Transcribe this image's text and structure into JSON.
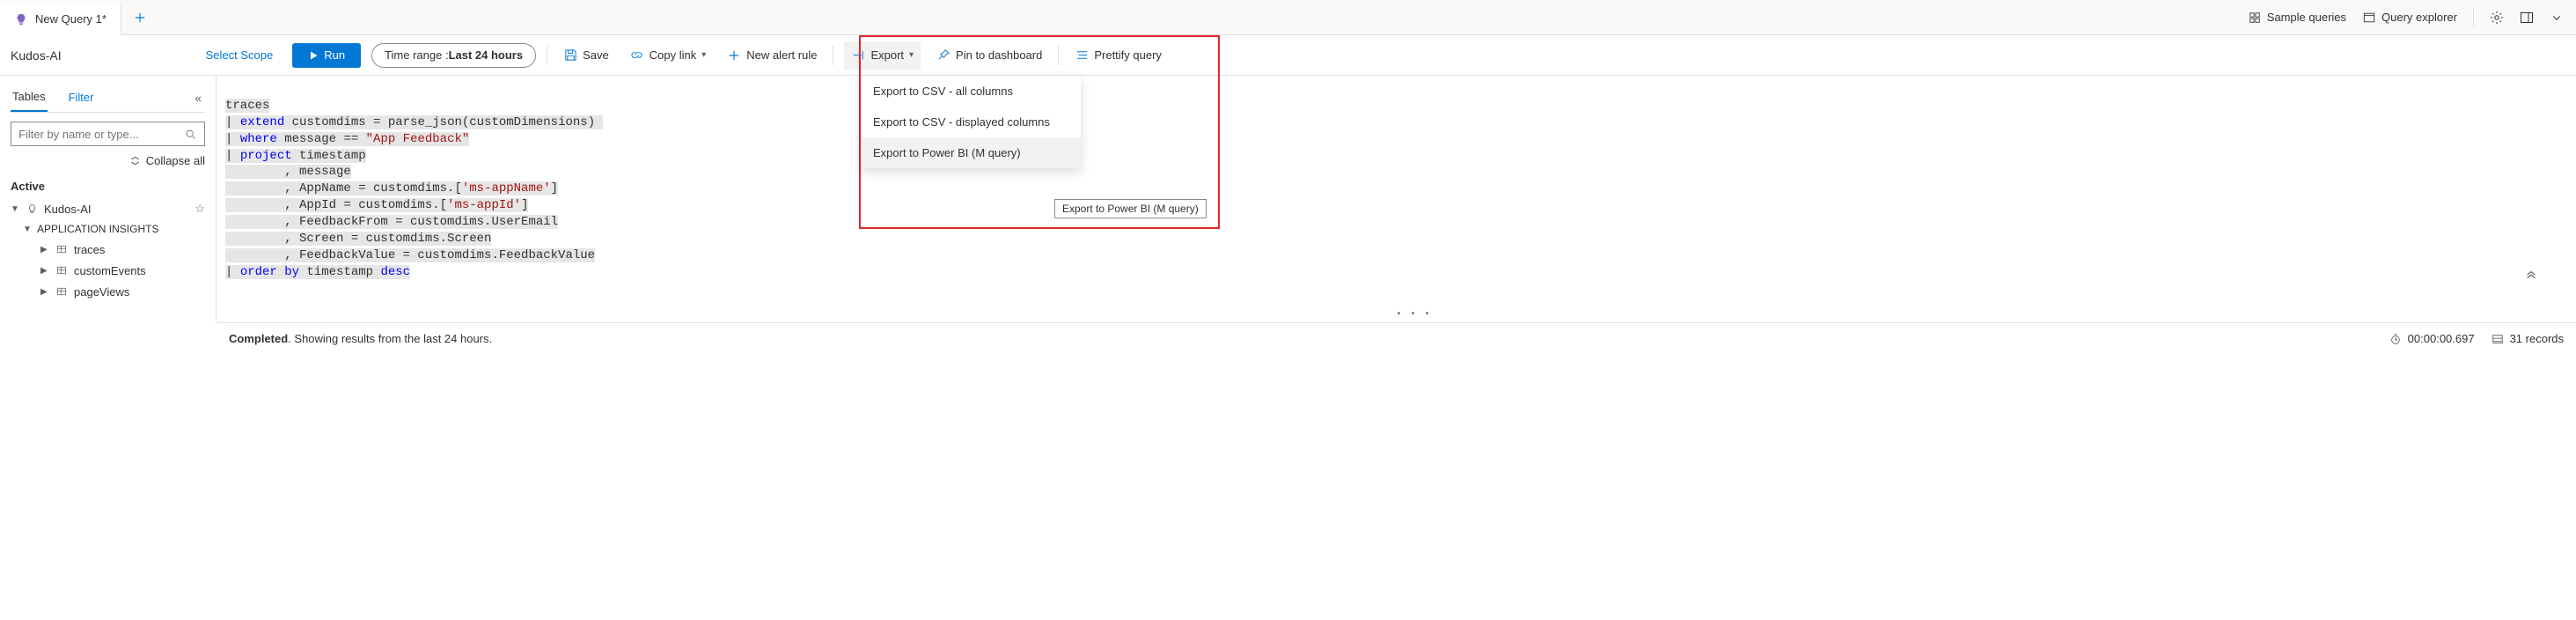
{
  "tabStrip": {
    "active": "New Query 1*",
    "right": {
      "sample": "Sample queries",
      "explorer": "Query explorer"
    }
  },
  "toolbar": {
    "breadcrumb": "Kudos-AI",
    "selectScope": "Select Scope",
    "run": "Run",
    "timeRangeLabel": "Time range : ",
    "timeRangeValue": "Last 24 hours",
    "save": "Save",
    "copy": "Copy link",
    "newAlert": "New alert rule",
    "export": "Export",
    "pin": "Pin to dashboard",
    "prettify": "Prettify query"
  },
  "exportMenu": {
    "items": [
      "Export to CSV - all columns",
      "Export to CSV - displayed columns",
      "Export to Power BI (M query)"
    ],
    "tooltip": "Export to Power BI (M query)"
  },
  "sidebar": {
    "tabs": {
      "tables": "Tables",
      "filter": "Filter"
    },
    "filterPlaceholder": "Filter by name or type...",
    "collapseAll": "Collapse all",
    "activeHdr": "Active",
    "root": "Kudos-AI",
    "group": "APPLICATION INSIGHTS",
    "items": [
      "traces",
      "customEvents",
      "pageViews"
    ]
  },
  "editor": {
    "line1": "traces",
    "extendKw": "extend",
    "extendRest": " customdims = parse_json(customDimensions)",
    "whereKw": "where",
    "whereMid": " message == ",
    "whereStr": "\"App Feedback\"",
    "projectKw": "project",
    "projectHead": " timestamp",
    "p1": "        , message",
    "p2a": "        , AppName = customdims.[",
    "p2s": "'ms-appName'",
    "p2b": "]",
    "p3a": "        , AppId = customdims.[",
    "p3s": "'ms-appId'",
    "p3b": "]",
    "p4": "        , FeedbackFrom = customdims.UserEmail",
    "p5": "        , Screen = customdims.Screen",
    "p6": "        , FeedbackValue = customdims.FeedbackValue",
    "orderKw": "order by",
    "orderRest": " timestamp ",
    "descKw": "desc"
  },
  "status": {
    "completed": "Completed",
    "sub": ". Showing results from the last 24 hours.",
    "time": "00:00:00.697",
    "records": "31 records"
  }
}
